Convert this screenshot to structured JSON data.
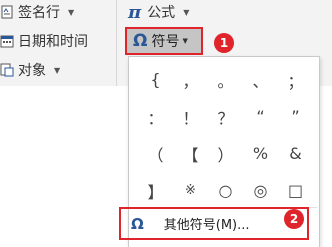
{
  "ribbon": {
    "signature_line": "签名行",
    "date_time": "日期和时间",
    "object": "对象",
    "equation": "公式",
    "symbol": "符号"
  },
  "badges": [
    "1",
    "2"
  ],
  "symbol_menu": {
    "symbols": [
      "{",
      "，",
      "。",
      "、",
      "；",
      "：",
      "！",
      "？",
      "“",
      "”",
      "（",
      "【",
      "）",
      "%",
      "&",
      "】",
      "※",
      "○",
      "◎",
      "□"
    ],
    "more_symbols": "其他符号(M)..."
  },
  "colors": {
    "highlight_border": "#e0242c",
    "badge": "#e0242c",
    "icon_blue": "#2b5797"
  },
  "icons": [
    "signature-icon",
    "calendar-icon",
    "object-icon",
    "pi-icon",
    "omega-icon"
  ]
}
